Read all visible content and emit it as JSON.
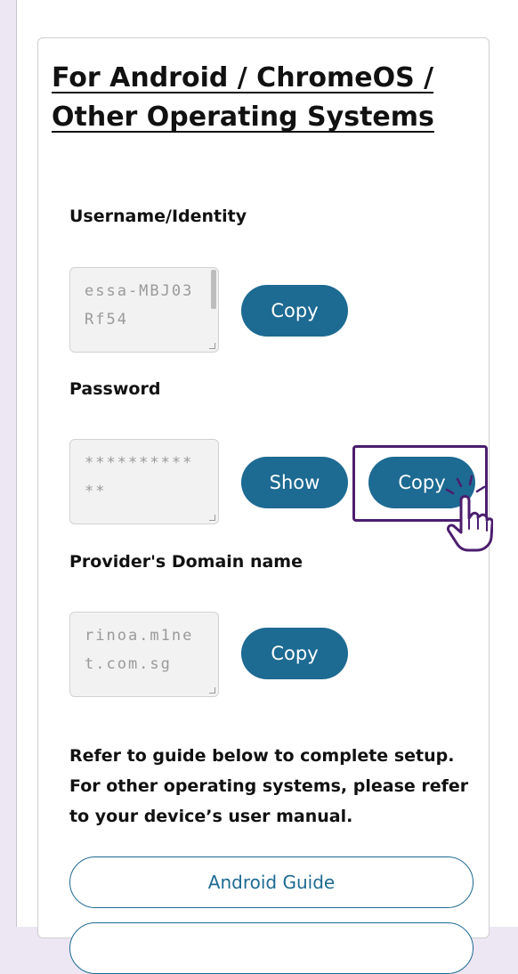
{
  "section": {
    "title": "For Android / ChromeOS / Other Operating Systems"
  },
  "username": {
    "label": "Username/Identity",
    "value": "essa-MBJ03Rf54",
    "copy_label": "Copy"
  },
  "password": {
    "label": "Password",
    "value": "************",
    "show_label": "Show",
    "copy_label": "Copy"
  },
  "domain": {
    "label": "Provider's Domain name",
    "value": "rinoa.m1net.com.sg",
    "copy_label": "Copy"
  },
  "guide": {
    "text": "Refer to guide below to complete setup. For other operating systems, please refer to your device’s user manual.",
    "android_button": "Android Guide",
    "second_button": ""
  },
  "colors": {
    "primary": "#1d6a92",
    "highlight": "#4b1d6e",
    "background": "#ede6f3"
  },
  "icons": {
    "pointer": "hand-pointer-icon"
  }
}
